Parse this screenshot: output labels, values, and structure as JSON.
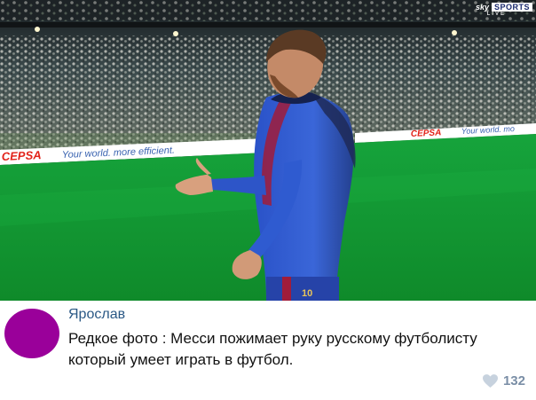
{
  "photo": {
    "description_icon": "football-photo",
    "broadcast": {
      "sky": "sky",
      "sports": "SPORTS",
      "live": "LIVE"
    },
    "ads": {
      "left_brand": "CEPSA",
      "left_slogan": "Your world. more efficient.",
      "right_brand": "CEPSA",
      "right_slogan": "Your world. mo"
    },
    "shirt_number": "10"
  },
  "comment": {
    "author": "Ярослав",
    "text": "Редкое фото : Месси пожимает руку русскому футболисту который умеет играть в футбол.",
    "likes_icon": "heart-icon",
    "likes_count": "132",
    "avatar_color": "#9a009a"
  }
}
